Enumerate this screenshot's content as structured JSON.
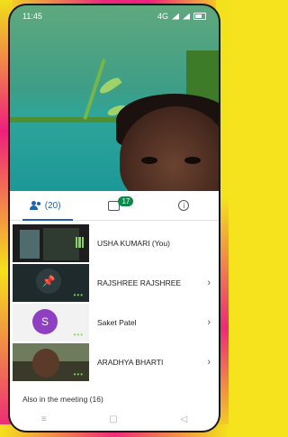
{
  "statusbar": {
    "time": "11:45",
    "network": "4G"
  },
  "tabs": [
    {
      "label": "(20)",
      "icon": "people-icon"
    },
    {
      "badge": "17",
      "icon": "chat-icon"
    },
    {
      "icon": "info-icon",
      "glyph": "i"
    }
  ],
  "participants": [
    {
      "name": "USHA KUMARI (You)"
    },
    {
      "name": "RAJSHREE RAJSHREE"
    },
    {
      "name": "Saket Patel",
      "initial": "S"
    },
    {
      "name": "ARADHYA BHARTI"
    }
  ],
  "section": {
    "title": "Also in the meeting (16)"
  },
  "navbar": {
    "recent": "≡",
    "home": "▢",
    "back": "◁"
  },
  "colors": {
    "accent": "#1e63b0",
    "badge": "#0c8a4a",
    "avatar": "#8e3fc2",
    "active_dots": "#7ed957"
  }
}
